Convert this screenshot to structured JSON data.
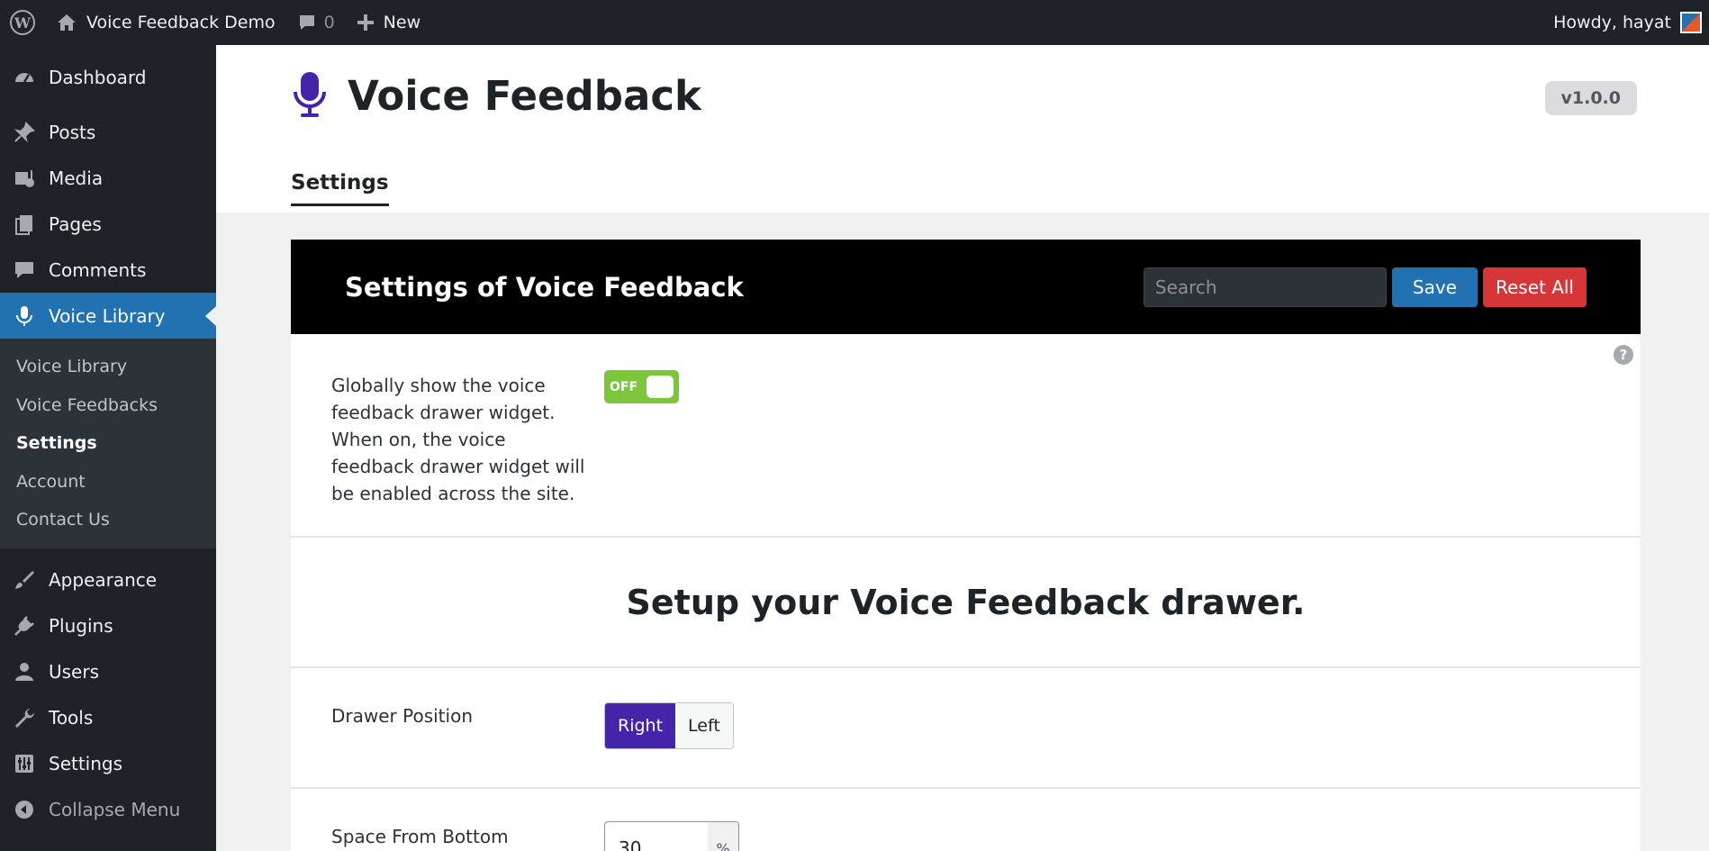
{
  "admin_bar": {
    "site_name": "Voice Feedback Demo",
    "comments_count": "0",
    "new_label": "New",
    "greeting": "Howdy, hayat"
  },
  "sidebar": {
    "items_top": [
      {
        "label": "Dashboard",
        "icon": "dashboard-icon"
      },
      {
        "label": "Posts",
        "icon": "pin-icon"
      },
      {
        "label": "Media",
        "icon": "media-icon"
      },
      {
        "label": "Pages",
        "icon": "pages-icon"
      },
      {
        "label": "Comments",
        "icon": "comment-icon"
      },
      {
        "label": "Voice Library",
        "icon": "microphone-icon"
      }
    ],
    "submenu": [
      "Voice Library",
      "Voice Feedbacks",
      "Settings",
      "Account",
      "Contact Us"
    ],
    "items_bottom": [
      {
        "label": "Appearance",
        "icon": "brush-icon"
      },
      {
        "label": "Plugins",
        "icon": "plug-icon"
      },
      {
        "label": "Users",
        "icon": "user-icon"
      },
      {
        "label": "Tools",
        "icon": "wrench-icon"
      },
      {
        "label": "Settings",
        "icon": "sliders-icon"
      },
      {
        "label": "Collapse Menu",
        "icon": "collapse-icon"
      }
    ]
  },
  "header": {
    "title": "Voice Feedback",
    "version": "v1.0.0",
    "tab": "Settings"
  },
  "panel": {
    "title": "Settings of Voice Feedback",
    "search_placeholder": "Search",
    "save_label": "Save",
    "reset_label": "Reset All",
    "help_glyph": "?",
    "global_toggle": {
      "description": "Globally show the voice feedback drawer widget. When on, the voice feedback drawer widget will be enabled across the site.",
      "state_label": "OFF"
    },
    "section_heading": "Setup your Voice Feedback drawer.",
    "drawer_position": {
      "label": "Drawer Position",
      "options": [
        "Right",
        "Left"
      ],
      "selected": "Right"
    },
    "space_from_bottom": {
      "label": "Space From Bottom",
      "value": "30",
      "unit": "%"
    }
  },
  "colors": {
    "accent_purple": "#4424a8",
    "wp_blue": "#2271b1",
    "reset_red": "#d63638",
    "toggle_green": "#7bc63a"
  }
}
